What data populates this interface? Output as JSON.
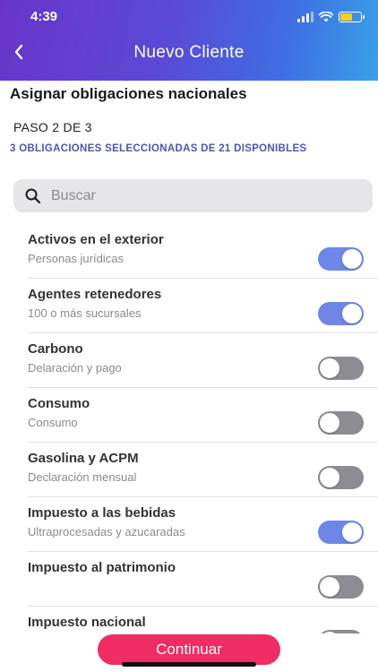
{
  "status": {
    "time": "4:39"
  },
  "header": {
    "title": "Nuevo Cliente",
    "back_icon": "chevron-left-icon"
  },
  "main": {
    "title": "Asignar obligaciones nacionales",
    "step": "PASO 2 DE 3",
    "selected_info": "3 OBLIGACIONES SELECCIONADAS DE 21 DISPONIBLES"
  },
  "search": {
    "placeholder": "Buscar",
    "value": ""
  },
  "obligations": [
    {
      "name": "Activos en el exterior",
      "subtitle": "Personas jurídicas",
      "enabled": true
    },
    {
      "name": "Agentes retenedores",
      "subtitle": "100 o más sucursales",
      "enabled": true
    },
    {
      "name": "Carbono",
      "subtitle": "Delaración y pago",
      "enabled": false
    },
    {
      "name": "Consumo",
      "subtitle": "Consumo",
      "enabled": false
    },
    {
      "name": "Gasolina y ACPM",
      "subtitle": "Declaración mensual",
      "enabled": false
    },
    {
      "name": "Impuesto a las bebidas",
      "subtitle": "Ultraprocesadas y azucaradas",
      "enabled": true
    },
    {
      "name": "Impuesto al patrimonio",
      "subtitle": "",
      "enabled": false
    },
    {
      "name": "Impuesto nacional",
      "subtitle": "",
      "enabled": false
    }
  ],
  "footer": {
    "continue_label": "Continuar"
  },
  "colors": {
    "accent": "#6e87e6",
    "primary_button": "#ef2c63",
    "highlight_text": "#4e55b0"
  }
}
